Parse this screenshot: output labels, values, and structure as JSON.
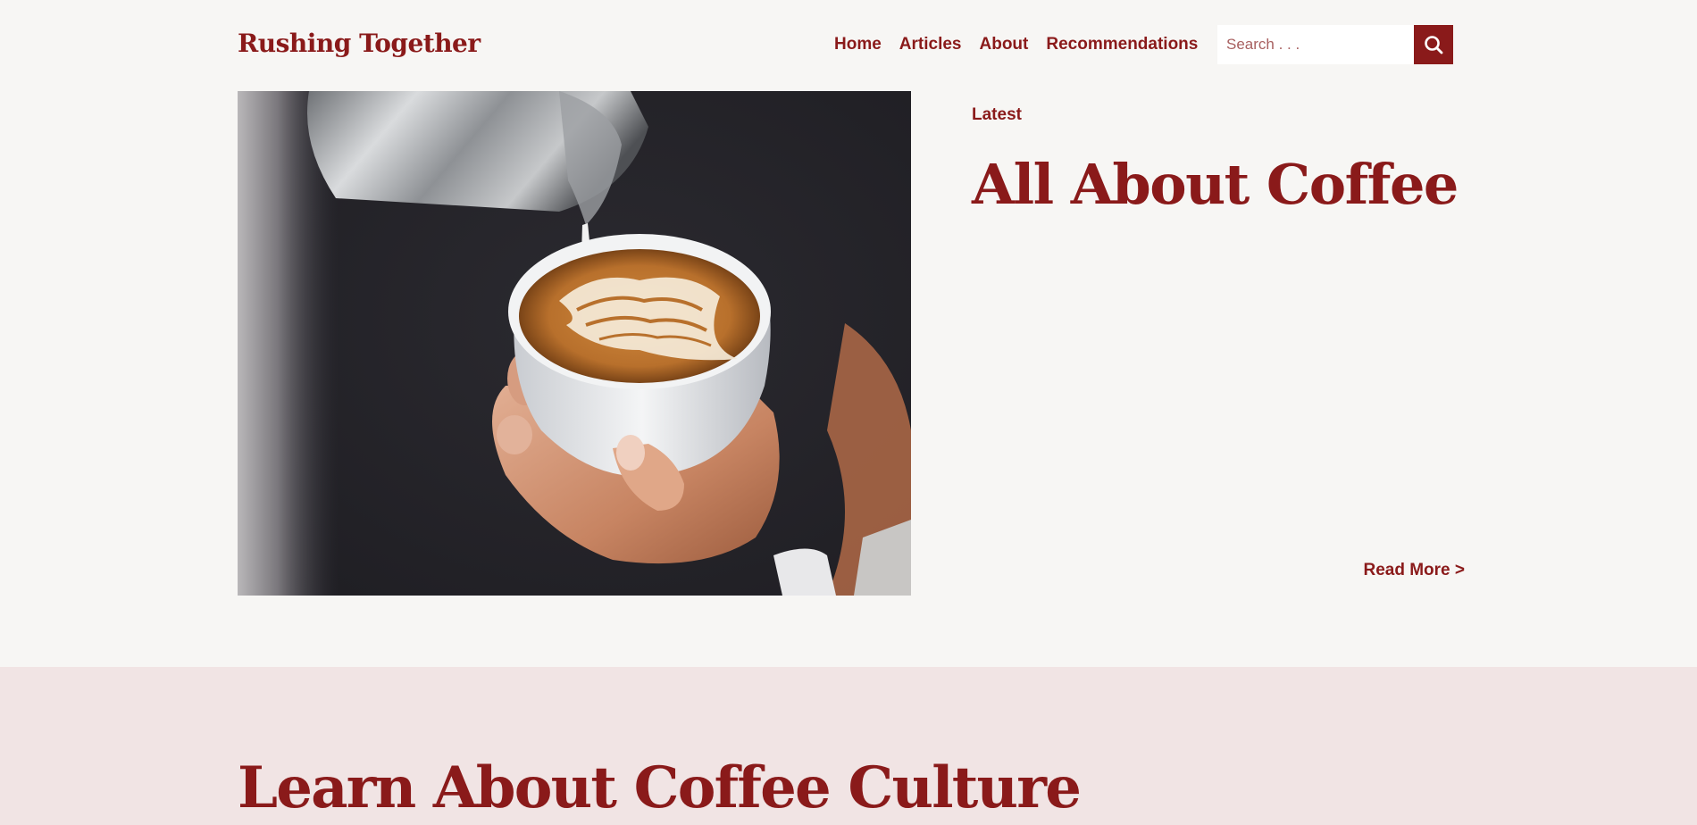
{
  "header": {
    "logo": "Rushing Together",
    "nav": [
      "Home",
      "Articles",
      "About",
      "Recommendations"
    ],
    "search_placeholder": "Search . . ."
  },
  "icons": {
    "search": "search-icon"
  },
  "colors": {
    "brand": "#8a1a1a",
    "background": "#f7f6f4",
    "band": "#f1e4e4"
  },
  "hero": {
    "image": "latte-art-pour",
    "eyebrow": "Latest",
    "title": "All About Coffee",
    "read_more": "Read More >"
  },
  "section": {
    "title": "Learn About Coffee Culture"
  }
}
